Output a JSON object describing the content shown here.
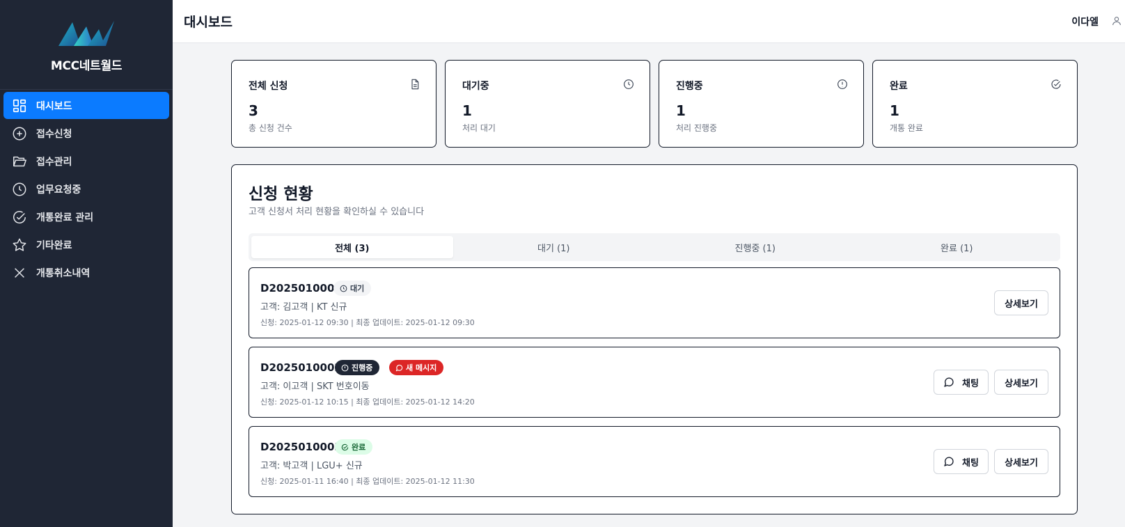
{
  "sidebar": {
    "brand_name": "MCC네트월드",
    "items": [
      {
        "label": "대시보드",
        "icon": "dashboard-icon",
        "active": true
      },
      {
        "label": "접수신청",
        "icon": "plus-circle-icon"
      },
      {
        "label": "접수관리",
        "icon": "folder-open-icon"
      },
      {
        "label": "업무요청중",
        "icon": "clock-icon"
      },
      {
        "label": "개통완료 관리",
        "icon": "check-circle-icon"
      },
      {
        "label": "기타완료",
        "icon": "star-icon"
      },
      {
        "label": "개통취소내역",
        "icon": "close-icon"
      }
    ]
  },
  "header": {
    "title": "대시보드",
    "user_name": "이다엘"
  },
  "stats": [
    {
      "label": "전체 신청",
      "value": "3",
      "desc": "총 신청 건수",
      "icon": "file-text-icon"
    },
    {
      "label": "대기중",
      "value": "1",
      "desc": "처리 대기",
      "icon": "clock-icon"
    },
    {
      "label": "진행중",
      "value": "1",
      "desc": "처리 진행중",
      "icon": "alert-circle-icon"
    },
    {
      "label": "완료",
      "value": "1",
      "desc": "개통 완료",
      "icon": "check-circle-icon"
    }
  ],
  "panel": {
    "title": "신청 현황",
    "subtitle": "고객 신청서 처리 현황을 확인하실 수 있습니다"
  },
  "tabs": [
    {
      "label": "전체 (3)",
      "active": true
    },
    {
      "label": "대기 (1)"
    },
    {
      "label": "진행중 (1)"
    },
    {
      "label": "완료 (1)"
    }
  ],
  "applications": [
    {
      "id": "D2025010001",
      "status": "대기",
      "customer": "고객: 김고객 | KT 신규",
      "dates": "신청: 2025-01-12 09:30 | 최종 업데이트: 2025-01-12 09:30",
      "detail_label": "상세보기"
    },
    {
      "id": "D2025010002",
      "status": "진행중",
      "new_message": "새 메시지",
      "customer": "고객: 이고객 | SKT 번호이동",
      "dates": "신청: 2025-01-12 10:15 | 최종 업데이트: 2025-01-12 14:20",
      "chat_label": "채팅",
      "detail_label": "상세보기"
    },
    {
      "id": "D2025010003",
      "status": "완료",
      "customer": "고객: 박고객 | LGU+ 신규",
      "dates": "신청: 2025-01-11 16:40 | 최종 업데이트: 2025-01-12 11:30",
      "chat_label": "채팅",
      "detail_label": "상세보기"
    }
  ],
  "colors": {
    "sidebar_bg": "#1f2635",
    "accent": "#0b7bff",
    "new_message": "#dc2626",
    "done_badge_bg": "#dcfce7"
  }
}
